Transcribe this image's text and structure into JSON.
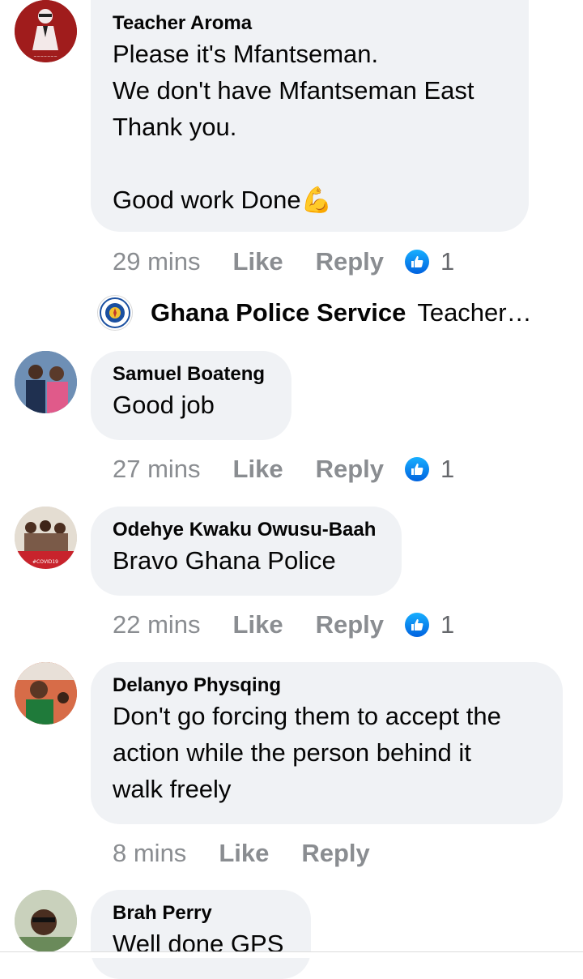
{
  "comments": [
    {
      "author": "Teacher Aroma",
      "lines": [
        "Please it's Mfantseman.",
        "We don't have Mfantseman East",
        "Thank you.",
        "",
        "Good work Done💪"
      ],
      "time": "29 mins",
      "like_label": "Like",
      "reply_label": "Reply",
      "reaction_count": "1"
    },
    {
      "author": "Samuel Boateng",
      "lines": [
        "Good job"
      ],
      "time": "27 mins",
      "like_label": "Like",
      "reply_label": "Reply",
      "reaction_count": "1"
    },
    {
      "author": "Odehye Kwaku Owusu-Baah",
      "lines": [
        "Bravo Ghana Police"
      ],
      "time": "22 mins",
      "like_label": "Like",
      "reply_label": "Reply",
      "reaction_count": "1"
    },
    {
      "author": "Delanyo Physqing",
      "lines": [
        "Don't go forcing them to accept the",
        "action while the person behind it",
        "walk freely"
      ],
      "time": "8 mins",
      "like_label": "Like",
      "reply_label": "Reply"
    },
    {
      "author": "Brah Perry",
      "lines": [
        "Well done GPS"
      ]
    }
  ],
  "reply_preview": {
    "author": "Ghana Police Service",
    "text": "Teacher…"
  },
  "colors": {
    "bubble": "#f0f2f5",
    "meta": "#8a8d91",
    "like_blue": "#1877f2"
  }
}
